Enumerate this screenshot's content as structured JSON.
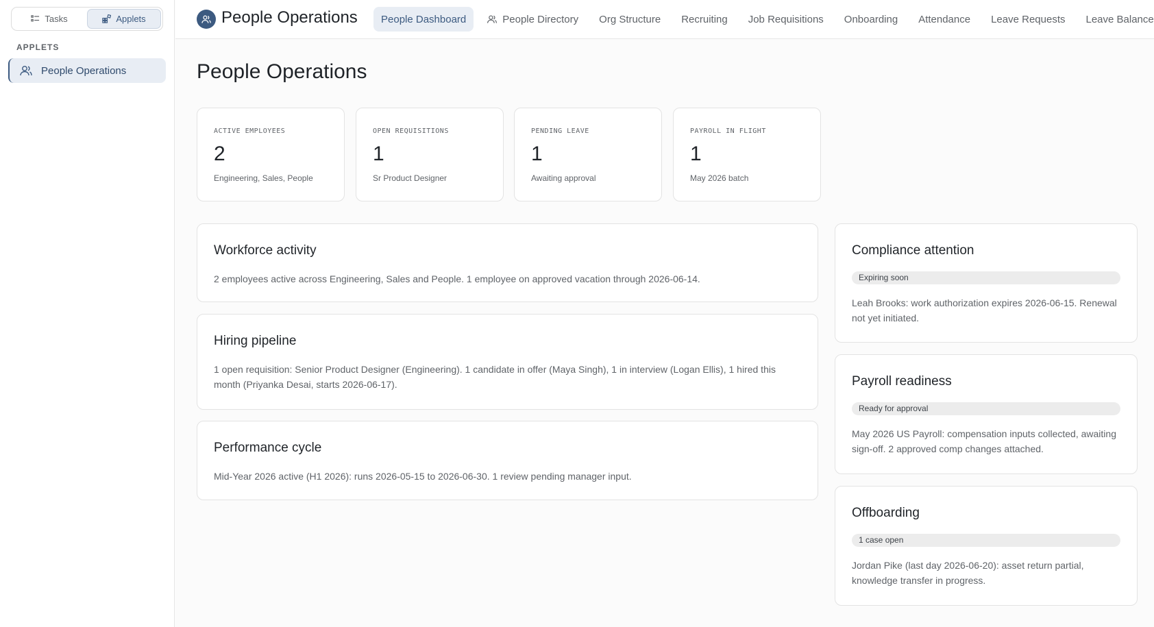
{
  "sidebar": {
    "segments": [
      {
        "label": "Tasks",
        "icon": "list-icon"
      },
      {
        "label": "Applets",
        "icon": "applets-icon"
      }
    ],
    "heading": "APPLETS",
    "items": [
      {
        "label": "People Operations",
        "icon": "users-icon"
      }
    ]
  },
  "header": {
    "title": "People Operations",
    "tabs": [
      {
        "label": "People Dashboard"
      },
      {
        "label": "People Directory"
      },
      {
        "label": "Org Structure"
      },
      {
        "label": "Recruiting"
      },
      {
        "label": "Job Requisitions"
      },
      {
        "label": "Onboarding"
      },
      {
        "label": "Attendance"
      },
      {
        "label": "Leave Requests"
      },
      {
        "label": "Leave Balances"
      }
    ]
  },
  "page": {
    "title": "People Operations"
  },
  "stats": [
    {
      "label": "ACTIVE EMPLOYEES",
      "value": "2",
      "sub": "Engineering, Sales, People"
    },
    {
      "label": "OPEN REQUISITIONS",
      "value": "1",
      "sub": "Sr Product Designer"
    },
    {
      "label": "PENDING LEAVE",
      "value": "1",
      "sub": "Awaiting approval"
    },
    {
      "label": "PAYROLL IN FLIGHT",
      "value": "1",
      "sub": "May 2026 batch"
    }
  ],
  "cards": {
    "workforce": {
      "title": "Workforce activity",
      "text": "2 employees active across Engineering, Sales and People. 1 employee on approved vacation through 2026-06-14."
    },
    "hiring": {
      "title": "Hiring pipeline",
      "text": "1 open requisition: Senior Product Designer (Engineering). 1 candidate in offer (Maya Singh), 1 in interview (Logan Ellis), 1 hired this month (Priyanka Desai, starts 2026-06-17)."
    },
    "performance": {
      "title": "Performance cycle",
      "text": "Mid-Year 2026 active (H1 2026): runs 2026-05-15 to 2026-06-30. 1 review pending manager input."
    },
    "compliance": {
      "title": "Compliance attention",
      "badge": "Expiring soon",
      "text": "Leah Brooks: work authorization expires 2026-06-15. Renewal not yet initiated."
    },
    "payroll": {
      "title": "Payroll readiness",
      "badge": "Ready for approval",
      "text": "May 2026 US Payroll: compensation inputs collected, awaiting sign-off. 2 approved comp changes attached."
    },
    "offboarding": {
      "title": "Offboarding",
      "badge": "1 case open",
      "text": "Jordan Pike (last day 2026-06-20): asset return partial, knowledge transfer in progress."
    }
  },
  "colors": {
    "accent": "#3c5a80",
    "accent_bg": "#e8edf4"
  }
}
